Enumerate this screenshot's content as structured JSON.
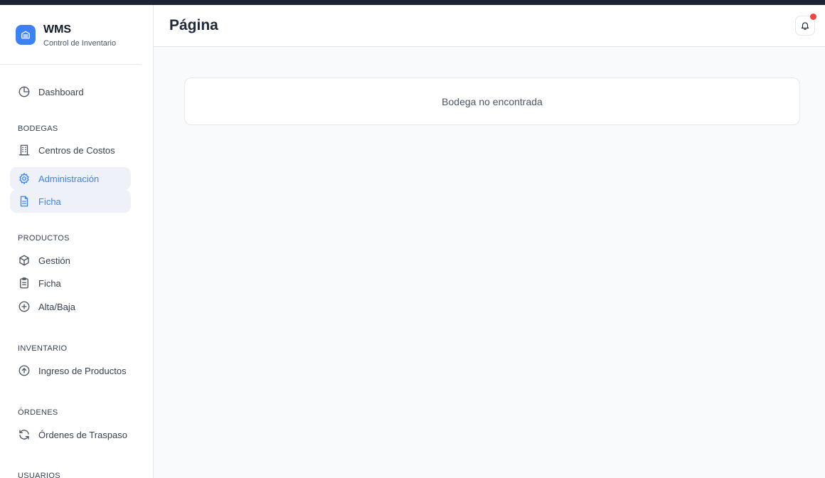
{
  "brand": {
    "title": "WMS",
    "subtitle": "Control de Inventario",
    "logo_icon": "warehouse-icon"
  },
  "sidebar": {
    "dashboard": {
      "label": "Dashboard",
      "icon": "pie-chart-icon"
    },
    "sections": [
      {
        "title": "BODEGAS",
        "items": [
          {
            "label": "Centros de Costos",
            "icon": "building-icon",
            "active": false
          },
          {
            "label": "Administración",
            "icon": "gear-icon",
            "active": true
          },
          {
            "label": "Ficha",
            "icon": "document-icon",
            "active": true
          }
        ]
      },
      {
        "title": "PRODUCTOS",
        "items": [
          {
            "label": "Gestión",
            "icon": "box-icon",
            "active": false
          },
          {
            "label": "Ficha",
            "icon": "clipboard-icon",
            "active": false
          },
          {
            "label": "Alta/Baja",
            "icon": "plus-circle-icon",
            "active": false
          }
        ]
      },
      {
        "title": "INVENTARIO",
        "items": [
          {
            "label": "Ingreso de Productos",
            "icon": "arrow-up-circle-icon",
            "active": false
          }
        ]
      },
      {
        "title": "ÓRDENES",
        "items": [
          {
            "label": "Órdenes de Traspaso",
            "icon": "refresh-icon",
            "active": false
          }
        ]
      },
      {
        "title": "USUARIOS",
        "items": []
      }
    ]
  },
  "header": {
    "title": "Página",
    "notification_icon": "bell-icon",
    "has_notification": true
  },
  "main": {
    "message": "Bodega no encontrada"
  },
  "colors": {
    "accent": "#3b82f6",
    "active_bg": "#eef2f8",
    "notification": "#ef4444",
    "topbar": "#1c2434"
  }
}
